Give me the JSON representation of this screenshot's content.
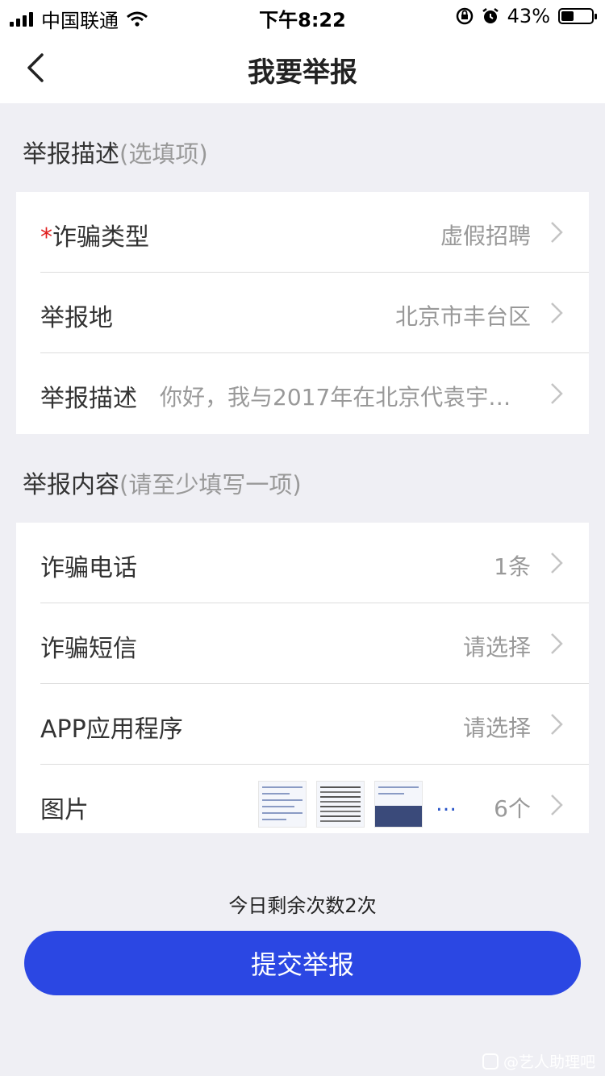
{
  "status_bar": {
    "carrier": "中国联通",
    "time": "下午8:22",
    "battery": "43%",
    "battery_level": 0.43
  },
  "nav": {
    "title": "我要举报"
  },
  "section_description": {
    "title": "举报描述",
    "hint": "(选填项)",
    "rows": [
      {
        "required": "*",
        "label": "诈骗类型",
        "value": "虚假招聘"
      },
      {
        "label": "举报地",
        "value": "北京市丰台区"
      },
      {
        "label": "举报描述",
        "value": "你好，我与2017年在北京代袁宇晨…"
      }
    ]
  },
  "section_content": {
    "title": "举报内容",
    "hint": "(请至少填写一项)",
    "rows": [
      {
        "label": "诈骗电话",
        "value": "1条"
      },
      {
        "label": "诈骗短信",
        "value": "请选择"
      },
      {
        "label": "APP应用程序",
        "value": "请选择"
      },
      {
        "label": "图片",
        "value": "6个",
        "more": "…"
      }
    ]
  },
  "footer": {
    "remaining": "今日剩余次数2次",
    "submit_label": "提交举报"
  },
  "watermark": "@艺人助理吧",
  "icons": [
    "signal-icon",
    "wifi-icon",
    "rotation-lock-icon",
    "alarm-icon",
    "battery-icon",
    "back-arrow-icon",
    "chevron-right-icon"
  ],
  "colors": {
    "accent": "#2b47e3",
    "required": "#e02020",
    "background": "#efeff4"
  }
}
